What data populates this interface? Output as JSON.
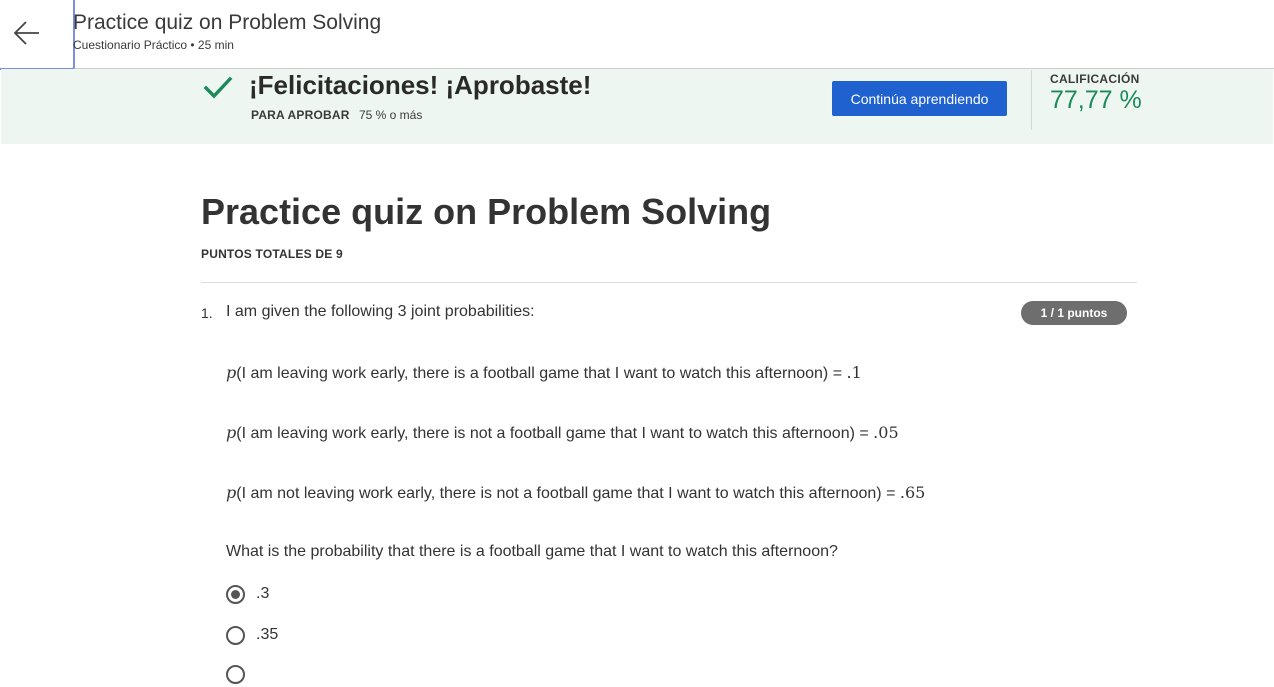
{
  "header": {
    "title": "Practice quiz on Problem Solving",
    "subtitle": "Cuestionario Práctico • 25 min",
    "back_icon": "arrow-left-icon"
  },
  "banner": {
    "title": "¡Felicitaciones! ¡Aprobaste!",
    "pass_label": "PARA APROBAR",
    "pass_value": "75 % o más",
    "continue_label": "Continúa aprendiendo",
    "grade_label": "CALIFICACIÓN",
    "grade_value": "77,77 %",
    "check_icon": "checkmark-icon",
    "accent_color": "#1d8a59",
    "button_color": "#1f62cf"
  },
  "quiz": {
    "title": "Practice quiz on Problem Solving",
    "total_points": "PUNTOS TOTALES DE 9"
  },
  "question1": {
    "number": "1.",
    "intro": "I am given the following 3 joint probabilities:",
    "score": "1 / 1 puntos",
    "lines": [
      {
        "p": "p",
        "text": "(I am leaving work early, there is a football game that I want to watch this afternoon) = ",
        "value": ".1"
      },
      {
        "p": "p",
        "text": "(I am leaving work early, there is not a football game that I want to watch this afternoon) = ",
        "value": ".05"
      },
      {
        "p": "p",
        "text": "(I am not leaving work early, there is not a football game that I want to watch this afternoon) = ",
        "value": ".65"
      }
    ],
    "question": "What is the probability that there is a football game that I want to watch this afternoon?",
    "options": [
      {
        "label": ".3",
        "selected": true
      },
      {
        "label": ".35",
        "selected": false
      }
    ]
  }
}
